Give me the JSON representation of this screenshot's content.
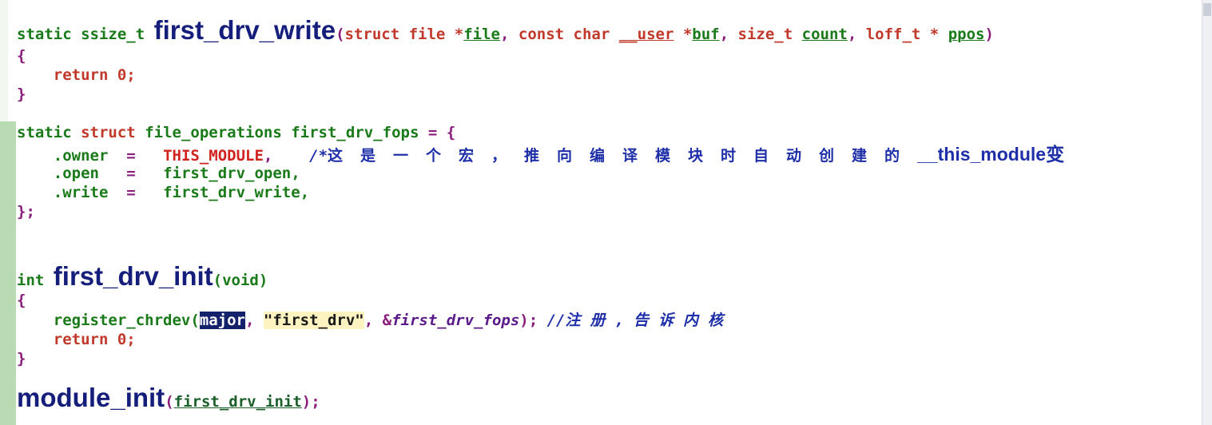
{
  "line1": {
    "kw_static": "static",
    "kw_type": "ssize_t",
    "fn_name": "first_drv_write",
    "lparen": "(",
    "p1_type": "struct file *",
    "p1_name": "file",
    "comma1": ",",
    "p2_type": "const char",
    "p2_user": "__user",
    "p2_star": "*",
    "p2_name": "buf",
    "comma2": ",",
    "p3_type": "size_t",
    "p3_name": "count",
    "comma3": ",",
    "p4_type": "loff_t *",
    "p4_name": "ppos",
    "rparen": ")"
  },
  "brace_open": "{",
  "brace_close": "}",
  "return_kw": "return",
  "return_val": "0;",
  "fops": {
    "kw_static": "static",
    "kw_struct": "struct",
    "type": "file_operations",
    "name": "first_drv_fops",
    "assign": "= {",
    "owner_field": ".owner",
    "eq": "=",
    "owner_val": "THIS_MODULE",
    "owner_comma": ",",
    "comment_start": "/*",
    "comment_cn": "这是一个宏，推向编译模块时自动创建的",
    "comment_tail": "__this_module变",
    "open_field": ".open",
    "open_val": "first_drv_open,",
    "write_field": ".write",
    "write_val": "first_drv_write,",
    "close": "};"
  },
  "init": {
    "kw_int": "int",
    "fn_name": "first_drv_init",
    "params": "(void)",
    "call_name": "register_chrdev(",
    "arg_major": "major",
    "comma": ",",
    "arg_str": "\"first_drv\"",
    "comma2": ",",
    "arg_amp": "&",
    "arg_fops": "first_drv_fops",
    "call_end": ");",
    "comment_slash": "//",
    "comment_cn": "注册,告诉内核"
  },
  "module_init": {
    "name": "module_init",
    "lparen": "(",
    "arg": "first_drv_init",
    "end": ");"
  }
}
